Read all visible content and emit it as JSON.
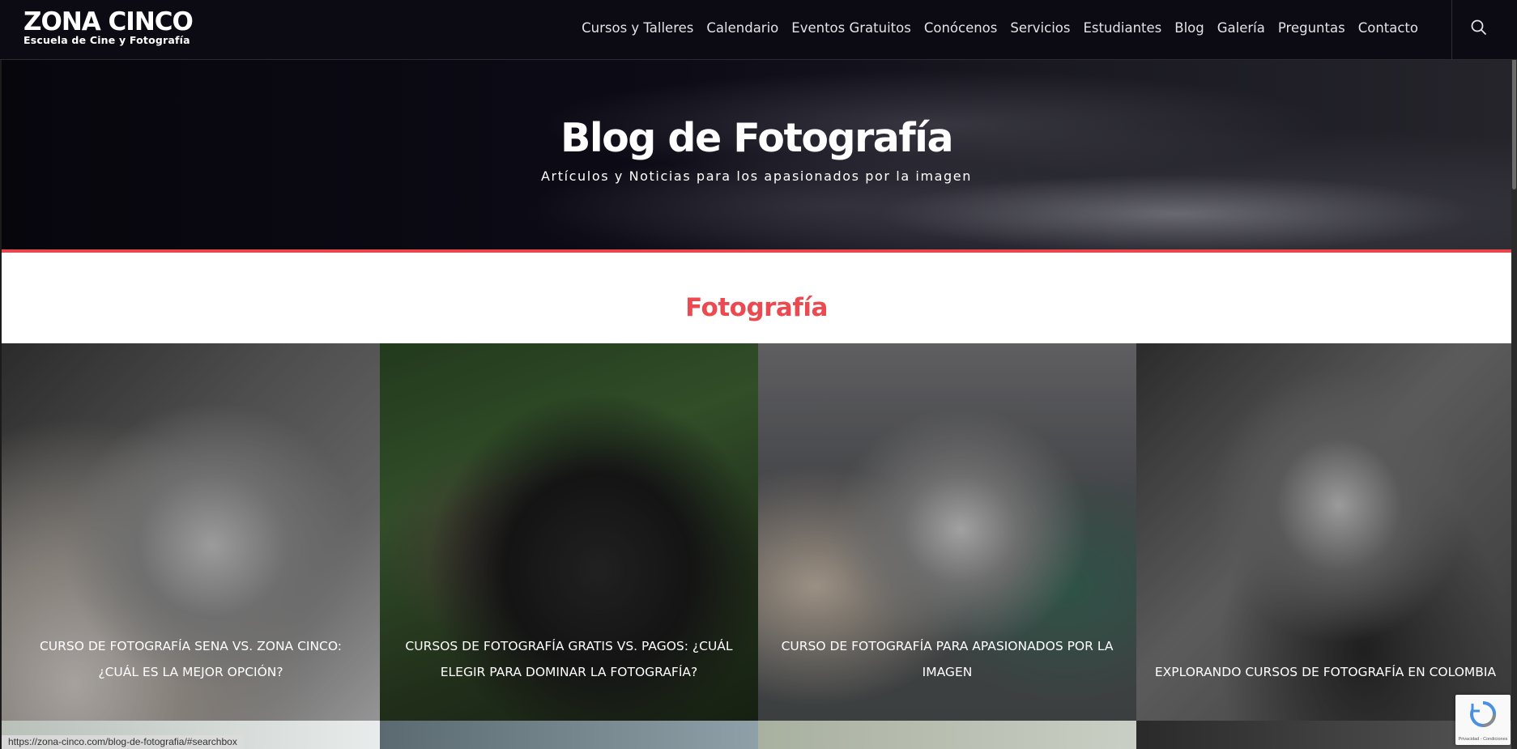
{
  "header": {
    "logo_main": "ZONA CINCO",
    "logo_sub": "Escuela de Cine y Fotografía",
    "nav": [
      "Cursos y Talleres",
      "Calendario",
      "Eventos Gratuitos",
      "Conócenos",
      "Servicios",
      "Estudiantes",
      "Blog",
      "Galería",
      "Preguntas",
      "Contacto"
    ],
    "search_icon": "search-icon"
  },
  "hero": {
    "title": "Blog de Fotografía",
    "subtitle": "Artículos y Noticias para los apasionados por la imagen",
    "accent_color": "#e8454d"
  },
  "section": {
    "title": "Fotografía",
    "title_color": "#ea4a50"
  },
  "posts": [
    {
      "title": "Curso de Fotografía SENA vs. Zona Cinco: ¿Cuál es la mejor opción?"
    },
    {
      "title": "Cursos de Fotografía Gratis vs. Pagos: ¿Cuál Elegir para Dominar la Fotografía?"
    },
    {
      "title": "Curso de Fotografía para Apasionados por la Imagen"
    },
    {
      "title": "Explorando Cursos de Fotografía en Colombia"
    }
  ],
  "status_bar": {
    "url": "https://zona-cinco.com/blog-de-fotografia/#searchbox"
  },
  "recaptcha": {
    "text": "Privacidad - Condiciones"
  }
}
